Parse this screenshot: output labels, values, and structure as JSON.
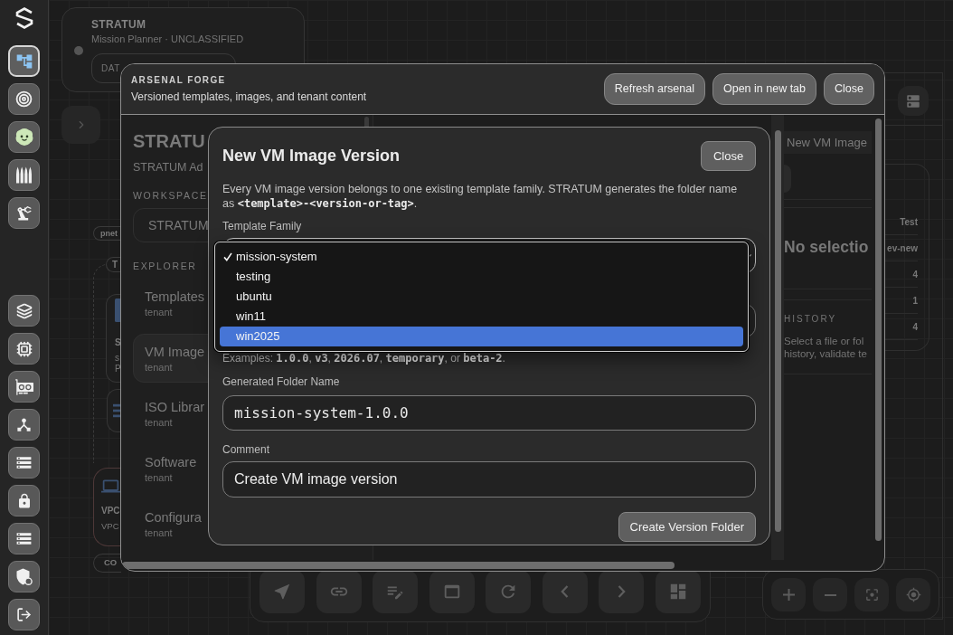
{
  "sidebar": {
    "primary": [
      {
        "selected": true
      },
      {
        "selected": false
      },
      {
        "selected": false
      },
      {
        "selected": false
      },
      {
        "selected": false
      }
    ],
    "secondary": [
      {
        "selected": false
      },
      {
        "selected": false
      },
      {
        "selected": false
      },
      {
        "selected": false
      },
      {
        "selected": false
      },
      {
        "selected": false
      },
      {
        "selected": false
      },
      {
        "selected": false
      },
      {
        "selected": false
      }
    ]
  },
  "canvas": {
    "header_card": {
      "title": "STRATUM",
      "subtitle": "Mission Planner · UNCLASSIFIED",
      "badge": "DAT"
    },
    "tags": {
      "network": "pnet",
      "group": "T",
      "footer": "CO"
    },
    "server_node": {
      "title": "S",
      "lines": [
        "s",
        "P"
      ]
    },
    "vpc_node": {
      "title": "VPC",
      "subtitle": "VPC"
    }
  },
  "side_panel": {
    "table": {
      "column": "Test",
      "rows": [
        "ev-new",
        "4",
        "1",
        "4"
      ]
    }
  },
  "arsenal_forge": {
    "eyebrow": "ARSENAL FORGE",
    "subtitle": "Versioned templates, images, and tenant content",
    "actions": [
      "Refresh arsenal",
      "Open in new tab",
      "Close"
    ],
    "explorer": {
      "title": "STRATU",
      "subtitle": "STRATUM Ad",
      "workspace_label": "WORKSPACE",
      "workspace_value": "STRATUM",
      "section_label": "EXPLORER",
      "items": [
        {
          "label": "Templates",
          "scope": "tenant",
          "selected": false
        },
        {
          "label": "VM Image",
          "scope": "tenant",
          "selected": true
        },
        {
          "label": "ISO Librar",
          "scope": "tenant",
          "selected": false
        },
        {
          "label": "Software",
          "scope": "tenant",
          "selected": false
        },
        {
          "label": "Configura",
          "scope": "tenant",
          "selected": false
        }
      ]
    },
    "editor": {
      "tab": "New VM Image",
      "empty_title": "No selectio",
      "history_label": "HISTORY",
      "history_text": [
        "Select a file or fol",
        "history, validate te"
      ]
    }
  },
  "dialog": {
    "title": "New VM Image Version",
    "close_button": "Close",
    "description": [
      {
        "kind": "text",
        "text": "Every VM image version belongs to one existing template family. STRATUM generates the folder name as "
      },
      {
        "kind": "code",
        "text": "<template>-<version-or-tag>"
      },
      {
        "kind": "text",
        "text": "."
      }
    ],
    "family": {
      "label": "Template Family",
      "options": [
        {
          "label": "mission-system",
          "selected": true,
          "highlighted": false
        },
        {
          "label": "testing",
          "selected": false,
          "highlighted": false
        },
        {
          "label": "ubuntu",
          "selected": false,
          "highlighted": false
        },
        {
          "label": "win11",
          "selected": false,
          "highlighted": false
        },
        {
          "label": "win2025",
          "selected": false,
          "highlighted": true
        }
      ]
    },
    "examples": [
      {
        "kind": "text",
        "text": "Examples: "
      },
      {
        "kind": "code",
        "text": "1.0.0"
      },
      {
        "kind": "text",
        "text": ", "
      },
      {
        "kind": "code",
        "text": "v3"
      },
      {
        "kind": "text",
        "text": ", "
      },
      {
        "kind": "code",
        "text": "2026.07"
      },
      {
        "kind": "text",
        "text": ", "
      },
      {
        "kind": "code",
        "text": "temporary"
      },
      {
        "kind": "text",
        "text": ", or "
      },
      {
        "kind": "code",
        "text": "beta-2"
      },
      {
        "kind": "text",
        "text": "."
      }
    ],
    "folder": {
      "label": "Generated Folder Name",
      "value": "mission-system-1.0.0"
    },
    "comment": {
      "label": "Comment",
      "value": "Create VM image version"
    },
    "submit_button": "Create Version Folder"
  }
}
